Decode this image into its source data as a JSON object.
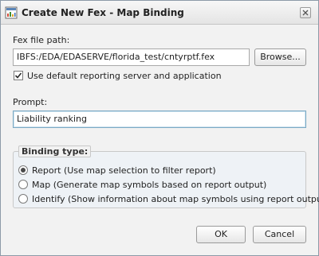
{
  "window": {
    "title": "Create New Fex - Map Binding"
  },
  "form": {
    "fex_path_label": "Fex file path:",
    "fex_path_value": "IBFS:/EDA/EDASERVE/florida_test/cntyrptf.fex",
    "browse_label": "Browse...",
    "default_server_label": "Use default reporting server and application",
    "default_server_checked": true,
    "prompt_label": "Prompt:",
    "prompt_value": "Liability ranking"
  },
  "binding": {
    "legend": "Binding type:",
    "selected": "report",
    "options": [
      {
        "id": "report",
        "label": "Report (Use map selection to filter report)"
      },
      {
        "id": "map",
        "label": "Map (Generate map symbols based on report output)"
      },
      {
        "id": "identify",
        "label": "Identify (Show information about map symbols using report output)"
      }
    ]
  },
  "buttons": {
    "ok": "OK",
    "cancel": "Cancel"
  }
}
